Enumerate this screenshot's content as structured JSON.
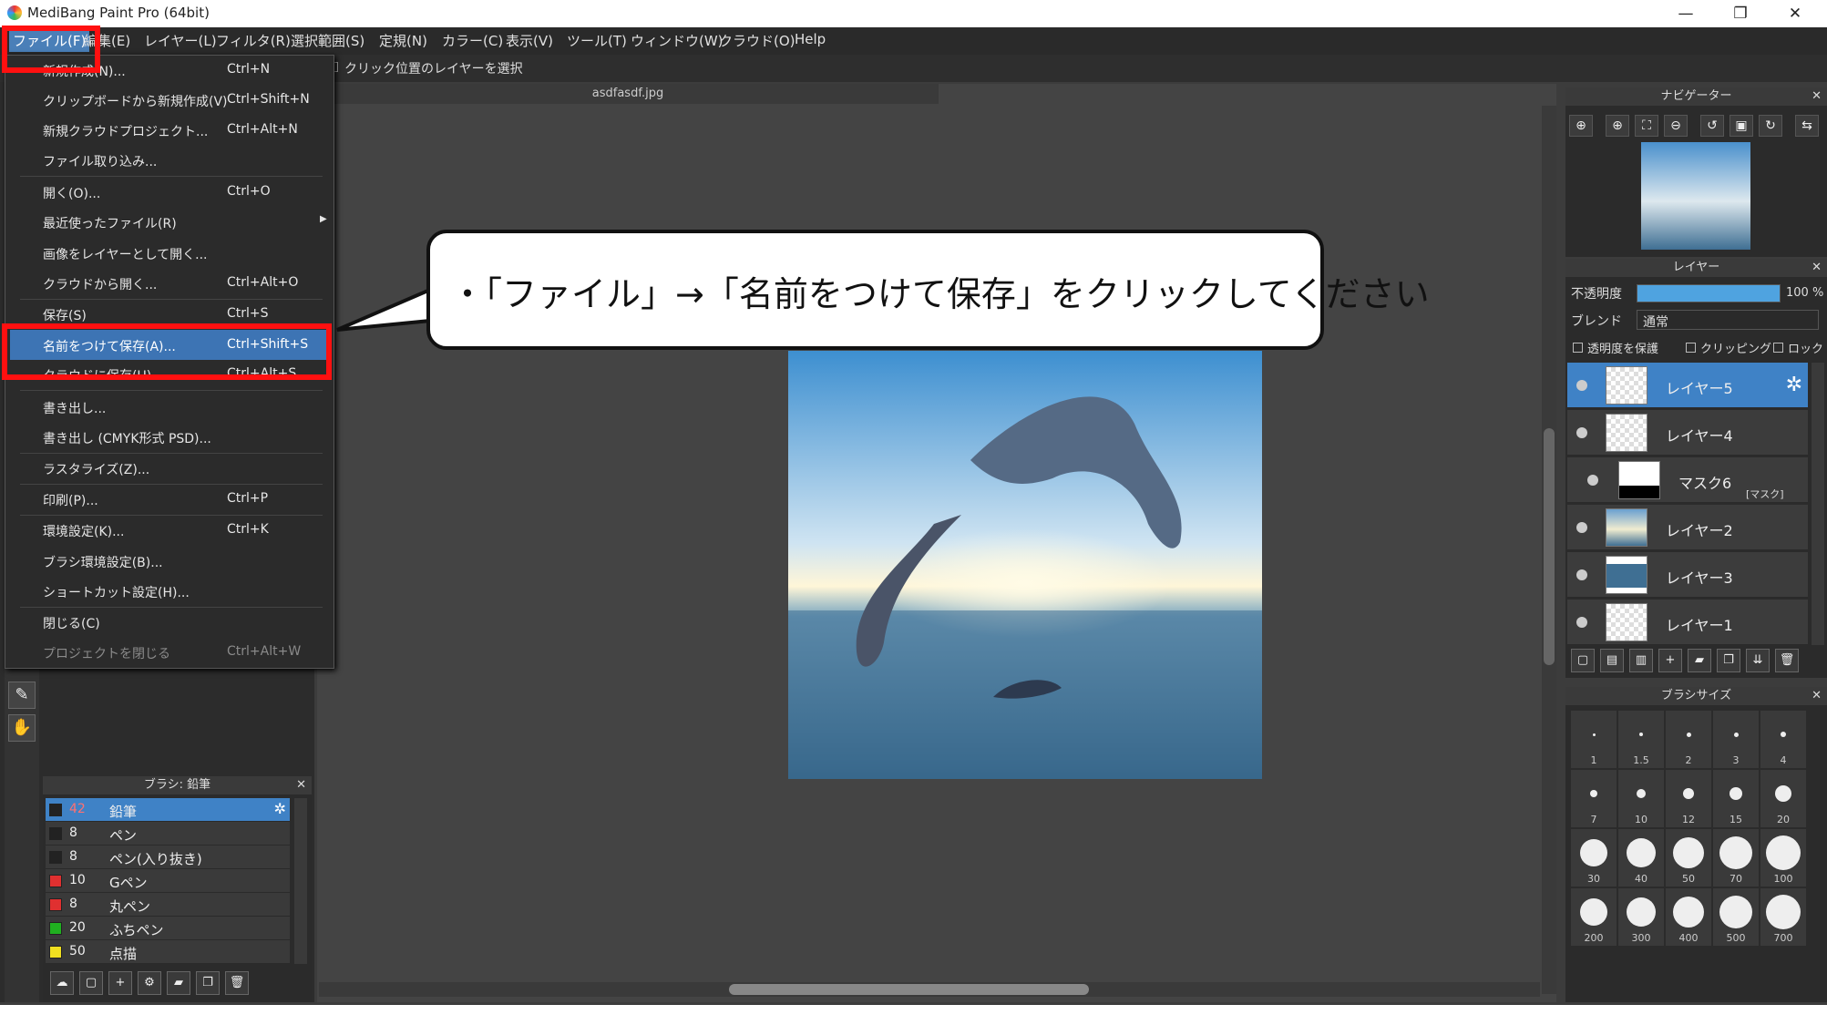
{
  "window": {
    "title": "MediBang Paint Pro (64bit)",
    "minimize": "—",
    "restore": "❐",
    "close": "✕"
  },
  "menubar": [
    "ファイル(F)",
    "編集(E)",
    "レイヤー(L)",
    "フィルタ(R)",
    "選択範囲(S)",
    "定規(N)",
    "カラー(C)",
    "表示(V)",
    "ツール(T)",
    "ウィンドウ(W)",
    "クラウド(O)",
    "Help"
  ],
  "tool_option": {
    "label": "クリック位置のレイヤーを選択"
  },
  "document": {
    "tab": "asdfasdf.jpg"
  },
  "file_menu": [
    {
      "label": "新規作成(N)...",
      "shortcut": "Ctrl+N"
    },
    {
      "label": "クリップボードから新規作成(V)",
      "shortcut": "Ctrl+Shift+N"
    },
    {
      "label": "新規クラウドプロジェクト...",
      "shortcut": "Ctrl+Alt+N"
    },
    {
      "label": "ファイル取り込み...",
      "shortcut": ""
    },
    {
      "label": "開く(O)...",
      "shortcut": "Ctrl+O"
    },
    {
      "label": "最近使ったファイル(R)",
      "shortcut": ""
    },
    {
      "label": "画像をレイヤーとして開く...",
      "shortcut": ""
    },
    {
      "label": "クラウドから開く...",
      "shortcut": "Ctrl+Alt+O"
    },
    {
      "label": "保存(S)",
      "shortcut": "Ctrl+S"
    },
    {
      "label": "名前をつけて保存(A)...",
      "shortcut": "Ctrl+Shift+S"
    },
    {
      "label": "クラウドに保存(U)...",
      "shortcut": "Ctrl+Alt+S"
    },
    {
      "label": "書き出し...",
      "shortcut": ""
    },
    {
      "label": "書き出し (CMYK形式 PSD)...",
      "shortcut": ""
    },
    {
      "label": "ラスタライズ(Z)...",
      "shortcut": ""
    },
    {
      "label": "印刷(P)...",
      "shortcut": "Ctrl+P"
    },
    {
      "label": "環境設定(K)...",
      "shortcut": "Ctrl+K"
    },
    {
      "label": "ブラシ環境設定(B)...",
      "shortcut": ""
    },
    {
      "label": "ショートカット設定(H)...",
      "shortcut": ""
    },
    {
      "label": "閉じる(C)",
      "shortcut": ""
    },
    {
      "label": "プロジェクトを閉じる",
      "shortcut": "Ctrl+Alt+W"
    }
  ],
  "callout": {
    "text": "・「ファイル」→「名前をつけて保存」をクリックしてください"
  },
  "navigator": {
    "title": "ナビゲーター"
  },
  "layers": {
    "title": "レイヤー",
    "opacity_label": "不透明度",
    "opacity_value": "100 %",
    "opacity_fraction": 1.0,
    "blend_label": "ブレンド",
    "blend_value": "通常",
    "protect_label": "透明度を保護",
    "clipping_label": "クリッピング",
    "lock_label": "ロック",
    "items": [
      {
        "name": "レイヤー5",
        "selected": true,
        "tag": ""
      },
      {
        "name": "レイヤー4",
        "selected": false,
        "tag": ""
      },
      {
        "name": "マスク6",
        "selected": false,
        "tag": "[マスク]"
      },
      {
        "name": "レイヤー2",
        "selected": false,
        "tag": ""
      },
      {
        "name": "レイヤー3",
        "selected": false,
        "tag": ""
      },
      {
        "name": "レイヤー1",
        "selected": false,
        "tag": ""
      }
    ]
  },
  "brush_size": {
    "title": "ブラシサイズ",
    "sizes": [
      "1",
      "1.5",
      "2",
      "3",
      "4",
      "7",
      "10",
      "12",
      "15",
      "20",
      "30",
      "40",
      "50",
      "70",
      "100",
      "200",
      "300",
      "400",
      "500",
      "700"
    ]
  },
  "brush_panel": {
    "title": "ブラシ: 鉛筆",
    "items": [
      {
        "size": "42",
        "name": "鉛筆",
        "color": "#222222",
        "selected": true
      },
      {
        "size": "8",
        "name": "ペン",
        "color": "#222222",
        "selected": false
      },
      {
        "size": "8",
        "name": "ペン(入り抜き)",
        "color": "#222222",
        "selected": false
      },
      {
        "size": "10",
        "name": "Gペン",
        "color": "#e03030",
        "selected": false
      },
      {
        "size": "8",
        "name": "丸ペン",
        "color": "#e03030",
        "selected": false
      },
      {
        "size": "20",
        "name": "ふちペン",
        "color": "#20b020",
        "selected": false
      },
      {
        "size": "50",
        "name": "点描",
        "color": "#f0e020",
        "selected": false
      }
    ]
  },
  "colors": {
    "highlight": "#3d74b4",
    "annotation_red": "#ff1010"
  }
}
